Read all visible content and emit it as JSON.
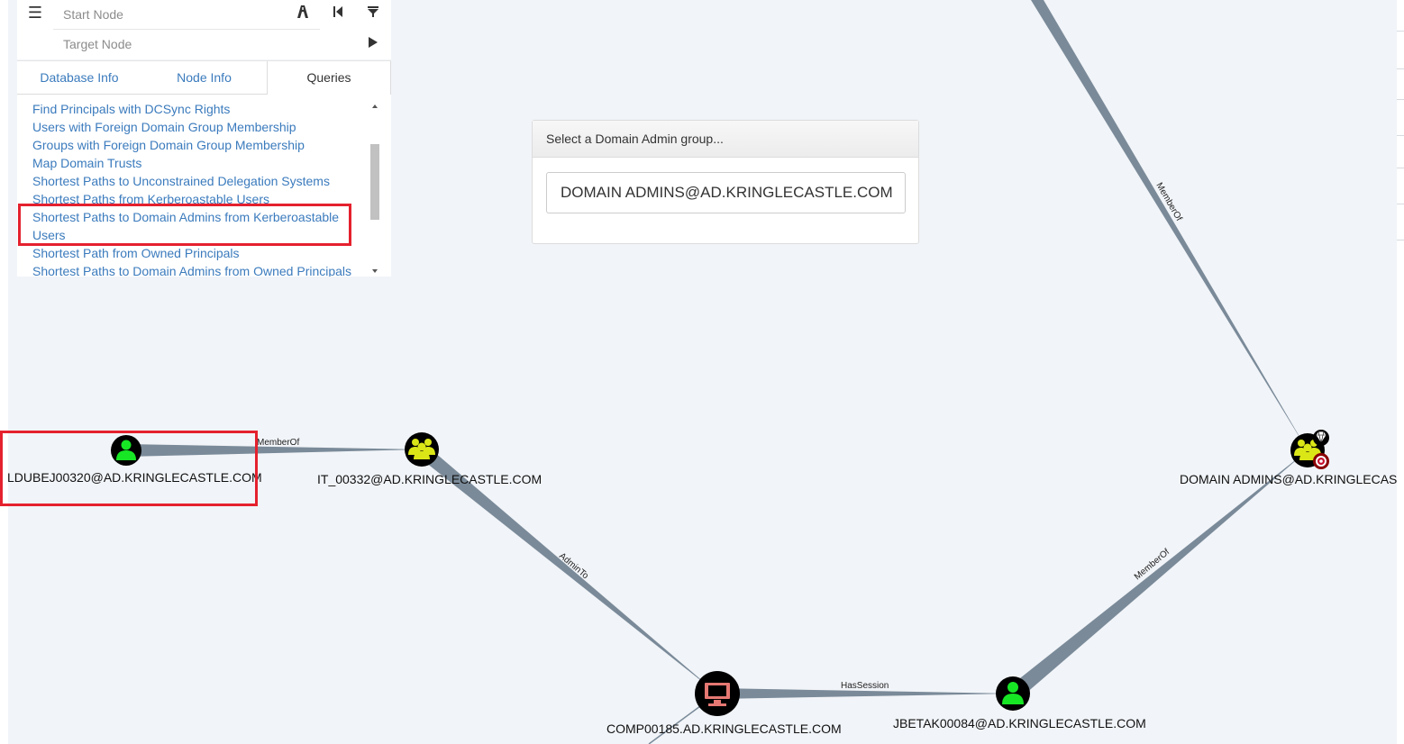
{
  "search": {
    "start_placeholder": "Start Node",
    "target_placeholder": "Target Node"
  },
  "tabs": [
    {
      "label": "Database Info",
      "active": false
    },
    {
      "label": "Node Info",
      "active": false
    },
    {
      "label": "Queries",
      "active": true
    }
  ],
  "queries": [
    "Find Principals with DCSync Rights",
    "Users with Foreign Domain Group Membership",
    "Groups with Foreign Domain Group Membership",
    "Map Domain Trusts",
    "Shortest Paths to Unconstrained Delegation Systems",
    "Shortest Paths from Kerberoastable Users",
    "Shortest Paths to Domain Admins from Kerberoastable Users",
    "Shortest Path from Owned Principals",
    "Shortest Paths to Domain Admins from Owned Principals"
  ],
  "highlighted_query": "Shortest Paths to Domain Admins from Kerberoastable Users",
  "domain_admin_modal": {
    "header": "Select a Domain Admin group...",
    "selected": "DOMAIN ADMINS@AD.KRINGLECASTLE.COM"
  },
  "graph": {
    "nodes": [
      {
        "id": "ldubej",
        "label": "LDUBEJ00320@AD.KRINGLECASTLE.COM",
        "type": "user"
      },
      {
        "id": "it",
        "label": "IT_00332@AD.KRINGLECASTLE.COM",
        "type": "group"
      },
      {
        "id": "comp",
        "label": "COMP00185.AD.KRINGLECASTLE.COM",
        "type": "computer"
      },
      {
        "id": "jbetak",
        "label": "JBETAK00084@AD.KRINGLECASTLE.COM",
        "type": "user"
      },
      {
        "id": "da",
        "label": "DOMAIN ADMINS@AD.KRINGLECASTLE.COM",
        "type": "group",
        "high_value": true
      }
    ],
    "edges": [
      {
        "label": "MemberOf"
      },
      {
        "label": "AdminTo"
      },
      {
        "label": "HasSession"
      },
      {
        "label": "MemberOf"
      },
      {
        "label": "MemberOf"
      }
    ]
  },
  "colors": {
    "user_node": "#17e625",
    "group_node": "#dbe617",
    "computer_node": "#e67873",
    "link": "#3b7bbd",
    "highlight": "#e5212e",
    "edge": "#7a8a99"
  }
}
